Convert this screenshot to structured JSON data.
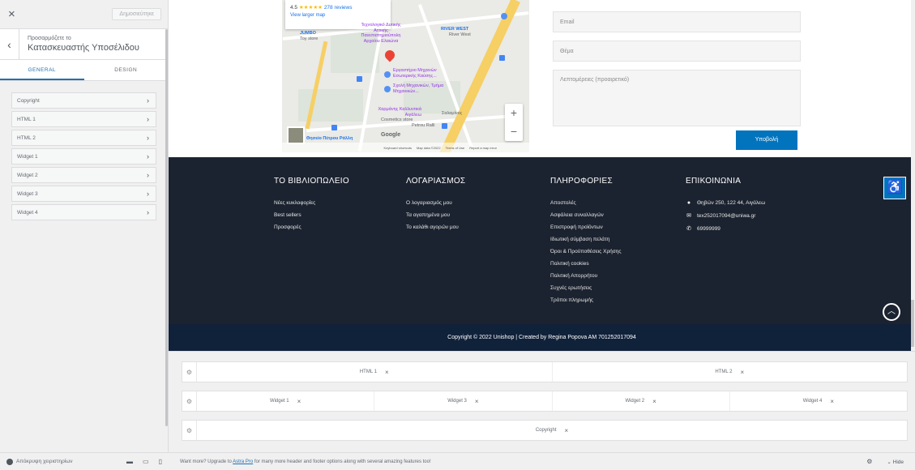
{
  "sidebar": {
    "close_label": "×",
    "publish_label": "Δημοσιεύτηκε",
    "back_label": "‹",
    "subtitle": "Προσαρμόζετε το",
    "title": "Κατασκευαστής Υποσέλιδου",
    "tabs": [
      {
        "label": "GENERAL",
        "active": true
      },
      {
        "label": "DESIGN",
        "active": false
      }
    ],
    "items": [
      {
        "label": "Copyright"
      },
      {
        "label": "HTML 1"
      },
      {
        "label": "HTML 2"
      },
      {
        "label": "Widget 1"
      },
      {
        "label": "Widget 2"
      },
      {
        "label": "Widget 3"
      },
      {
        "label": "Widget 4"
      }
    ],
    "hide_controls_label": "Απόκρυψη χειριστηρίων"
  },
  "map": {
    "rating": "4.5",
    "stars": "★★★★★",
    "reviews": "278 reviews",
    "larger_map": "View larger map",
    "labels": {
      "river_west": "RIVER WEST",
      "river_west_sub": "River West",
      "ergastirio": "Εργαστήριο Μηχανών Εσωτερικής Καύσης...",
      "sxoli": "Σχολή Μηχανικών, Τμήμα Μηχανικών...",
      "xarmanis": "Χαρμάνης Καλλυντικά Αιγάλεω",
      "xarmanis_sub": "Cosmetics store",
      "petrou_ralli": "Petrou Ralli",
      "salamineos": "Σαλαμίνος",
      "thiseio": "Θησείο Πέτρου Ράλλη",
      "library": "Τεχνολογικό Δυτικής Αττικής Πανεπιστημιούπολη Αρχαίου Ελαιώνα",
      "jumbo": "JUMBO",
      "jumbo_sub": "Toy store",
      "google": "Google"
    },
    "footer_links": [
      "Keyboard shortcuts",
      "Map data ©2022",
      "Terms of Use",
      "Report a map error"
    ],
    "zoom_in": "+",
    "zoom_out": "−"
  },
  "form": {
    "email_placeholder": "Email",
    "subject_placeholder": "Θέμα",
    "details_placeholder": "Λεπτομέρειες (προαιρετικό)",
    "submit_label": "Υποβολή"
  },
  "footer": {
    "columns": [
      {
        "title": "ΤΟ ΒΙΒΛΙΟΠΩΛΕΙΟ",
        "items": [
          "Νέες κυκλοφορίες",
          "Best sellers",
          "Προσφορές"
        ]
      },
      {
        "title": "ΛΟΓΑΡΙΑΣΜΟΣ",
        "items": [
          "Ο λογαριασμός μου",
          "Τα αγαπημένα μου",
          "Το καλάθι αγορών μου"
        ]
      },
      {
        "title": "ΠΛΗΡΟΦΟΡΙΕΣ",
        "items": [
          "Αποστολές",
          "Ασφάλεια συναλλαγών",
          "Επιστροφή προϊόντων",
          "Ιδιωτική σύμβαση πελάτη",
          "Όροι & Προϋποθέσεις Χρήσης",
          "Πολιτική cookies",
          "Πολιτική Απορρήτου",
          "Συχνές ερωτήσεις",
          "Τρόποι πληρωμής"
        ]
      }
    ],
    "contact": {
      "title": "ΕΠΙΚΟΙΝΩΝΙΑ",
      "address": "Θηβών 250, 122 44, Αιγάλεω",
      "email": "tex252017094@uniwa.gr",
      "phone": "69999999"
    },
    "copyright": "Copyright © 2022 Unishop | Created by Regina Popova AM 701252017094"
  },
  "builder": {
    "rows": [
      {
        "zones": [
          [
            "HTML 1"
          ],
          [
            "HTML 2"
          ]
        ]
      },
      {
        "zones": [
          [
            "Widget 1"
          ],
          [
            "Widget 3"
          ],
          [
            "Widget 2"
          ],
          [
            "Widget 4"
          ]
        ]
      },
      {
        "zones": [
          [
            "Copyright"
          ]
        ]
      }
    ]
  },
  "bottombar": {
    "msg_before": "Want more? Upgrade to ",
    "msg_link": "Astra Pro",
    "msg_after": " for many more header and footer options along with several amazing features too!",
    "hide_label": "Hide"
  },
  "colors": {
    "accent": "#0274be",
    "footer_bg": "#1c2330",
    "copyright_bg": "#10213a",
    "wp_blue": "#2271b1"
  }
}
